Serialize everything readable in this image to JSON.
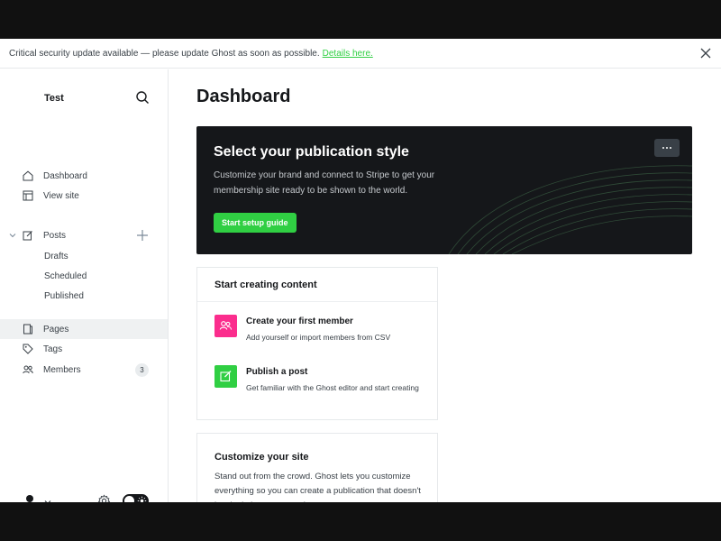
{
  "banner": {
    "message": "Critical security update available — please update Ghost as soon as possible.",
    "link_text": "Details here."
  },
  "sidebar": {
    "site_title": "Test",
    "items": [
      {
        "label": "Dashboard",
        "icon": "home-icon"
      },
      {
        "label": "View site",
        "icon": "layout-icon"
      },
      {
        "label": "Posts",
        "icon": "edit-icon"
      },
      {
        "label": "Drafts"
      },
      {
        "label": "Scheduled"
      },
      {
        "label": "Published"
      },
      {
        "label": "Pages",
        "icon": "pages-icon",
        "active": true
      },
      {
        "label": "Tags",
        "icon": "tag-icon"
      },
      {
        "label": "Members",
        "icon": "members-icon",
        "count": "3"
      }
    ]
  },
  "main": {
    "page_title": "Dashboard",
    "hero": {
      "title": "Select your publication style",
      "description": "Customize your brand and connect to Stripe to get your membership site ready to be shown to the world.",
      "cta": "Start setup guide"
    },
    "content_card": {
      "title": "Start creating content",
      "tasks": [
        {
          "title": "Create your first member",
          "description": "Add yourself or import members from CSV",
          "color": "#fb2d8d"
        },
        {
          "title": "Publish a post",
          "description": "Get familiar with the Ghost editor and start creating",
          "color": "#30cf43"
        }
      ]
    },
    "customize_card": {
      "title": "Customize your site",
      "description": "Stand out from the crowd. Ghost lets you customize everything so you can create a publication that doesn't just look the same as what"
    }
  },
  "colors": {
    "accent": "#30cf43",
    "pink": "#fb2d8d",
    "dark": "#15171a"
  }
}
